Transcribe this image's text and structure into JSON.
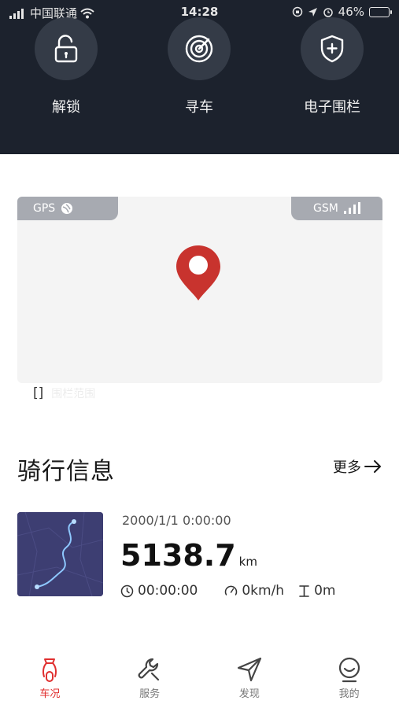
{
  "status_bar": {
    "carrier": "中国联通",
    "time": "14:28",
    "battery_percent": "46%",
    "battery_level": 0.46
  },
  "actions": [
    {
      "label": "解锁",
      "icon": "unlock-icon"
    },
    {
      "label": "寻车",
      "icon": "radar-icon"
    },
    {
      "label": "电子围栏",
      "icon": "shield-plus-icon"
    }
  ],
  "map": {
    "gps_label": "GPS",
    "gsm_label": "GSM",
    "fence_bracket": "[]",
    "fence_label": "围栏范围",
    "pin_color": "#c8332e"
  },
  "ride": {
    "section_title": "骑行信息",
    "more_label": "更多",
    "date": "2000/1/1 0:00:00",
    "distance": "5138.7",
    "distance_unit": "km",
    "duration": "00:00:00",
    "speed": "0km/h",
    "elevation": "0m"
  },
  "tabs": [
    {
      "label": "车况",
      "icon": "scooter-icon",
      "active": true
    },
    {
      "label": "服务",
      "icon": "wrench-icon",
      "active": false
    },
    {
      "label": "发现",
      "icon": "navigation-icon",
      "active": false
    },
    {
      "label": "我的",
      "icon": "profile-icon",
      "active": false
    }
  ],
  "colors": {
    "top_background": "#1c222d",
    "accent": "#e02f2f",
    "battery_green": "#62d24b",
    "route_line": "#8ec8ff"
  }
}
